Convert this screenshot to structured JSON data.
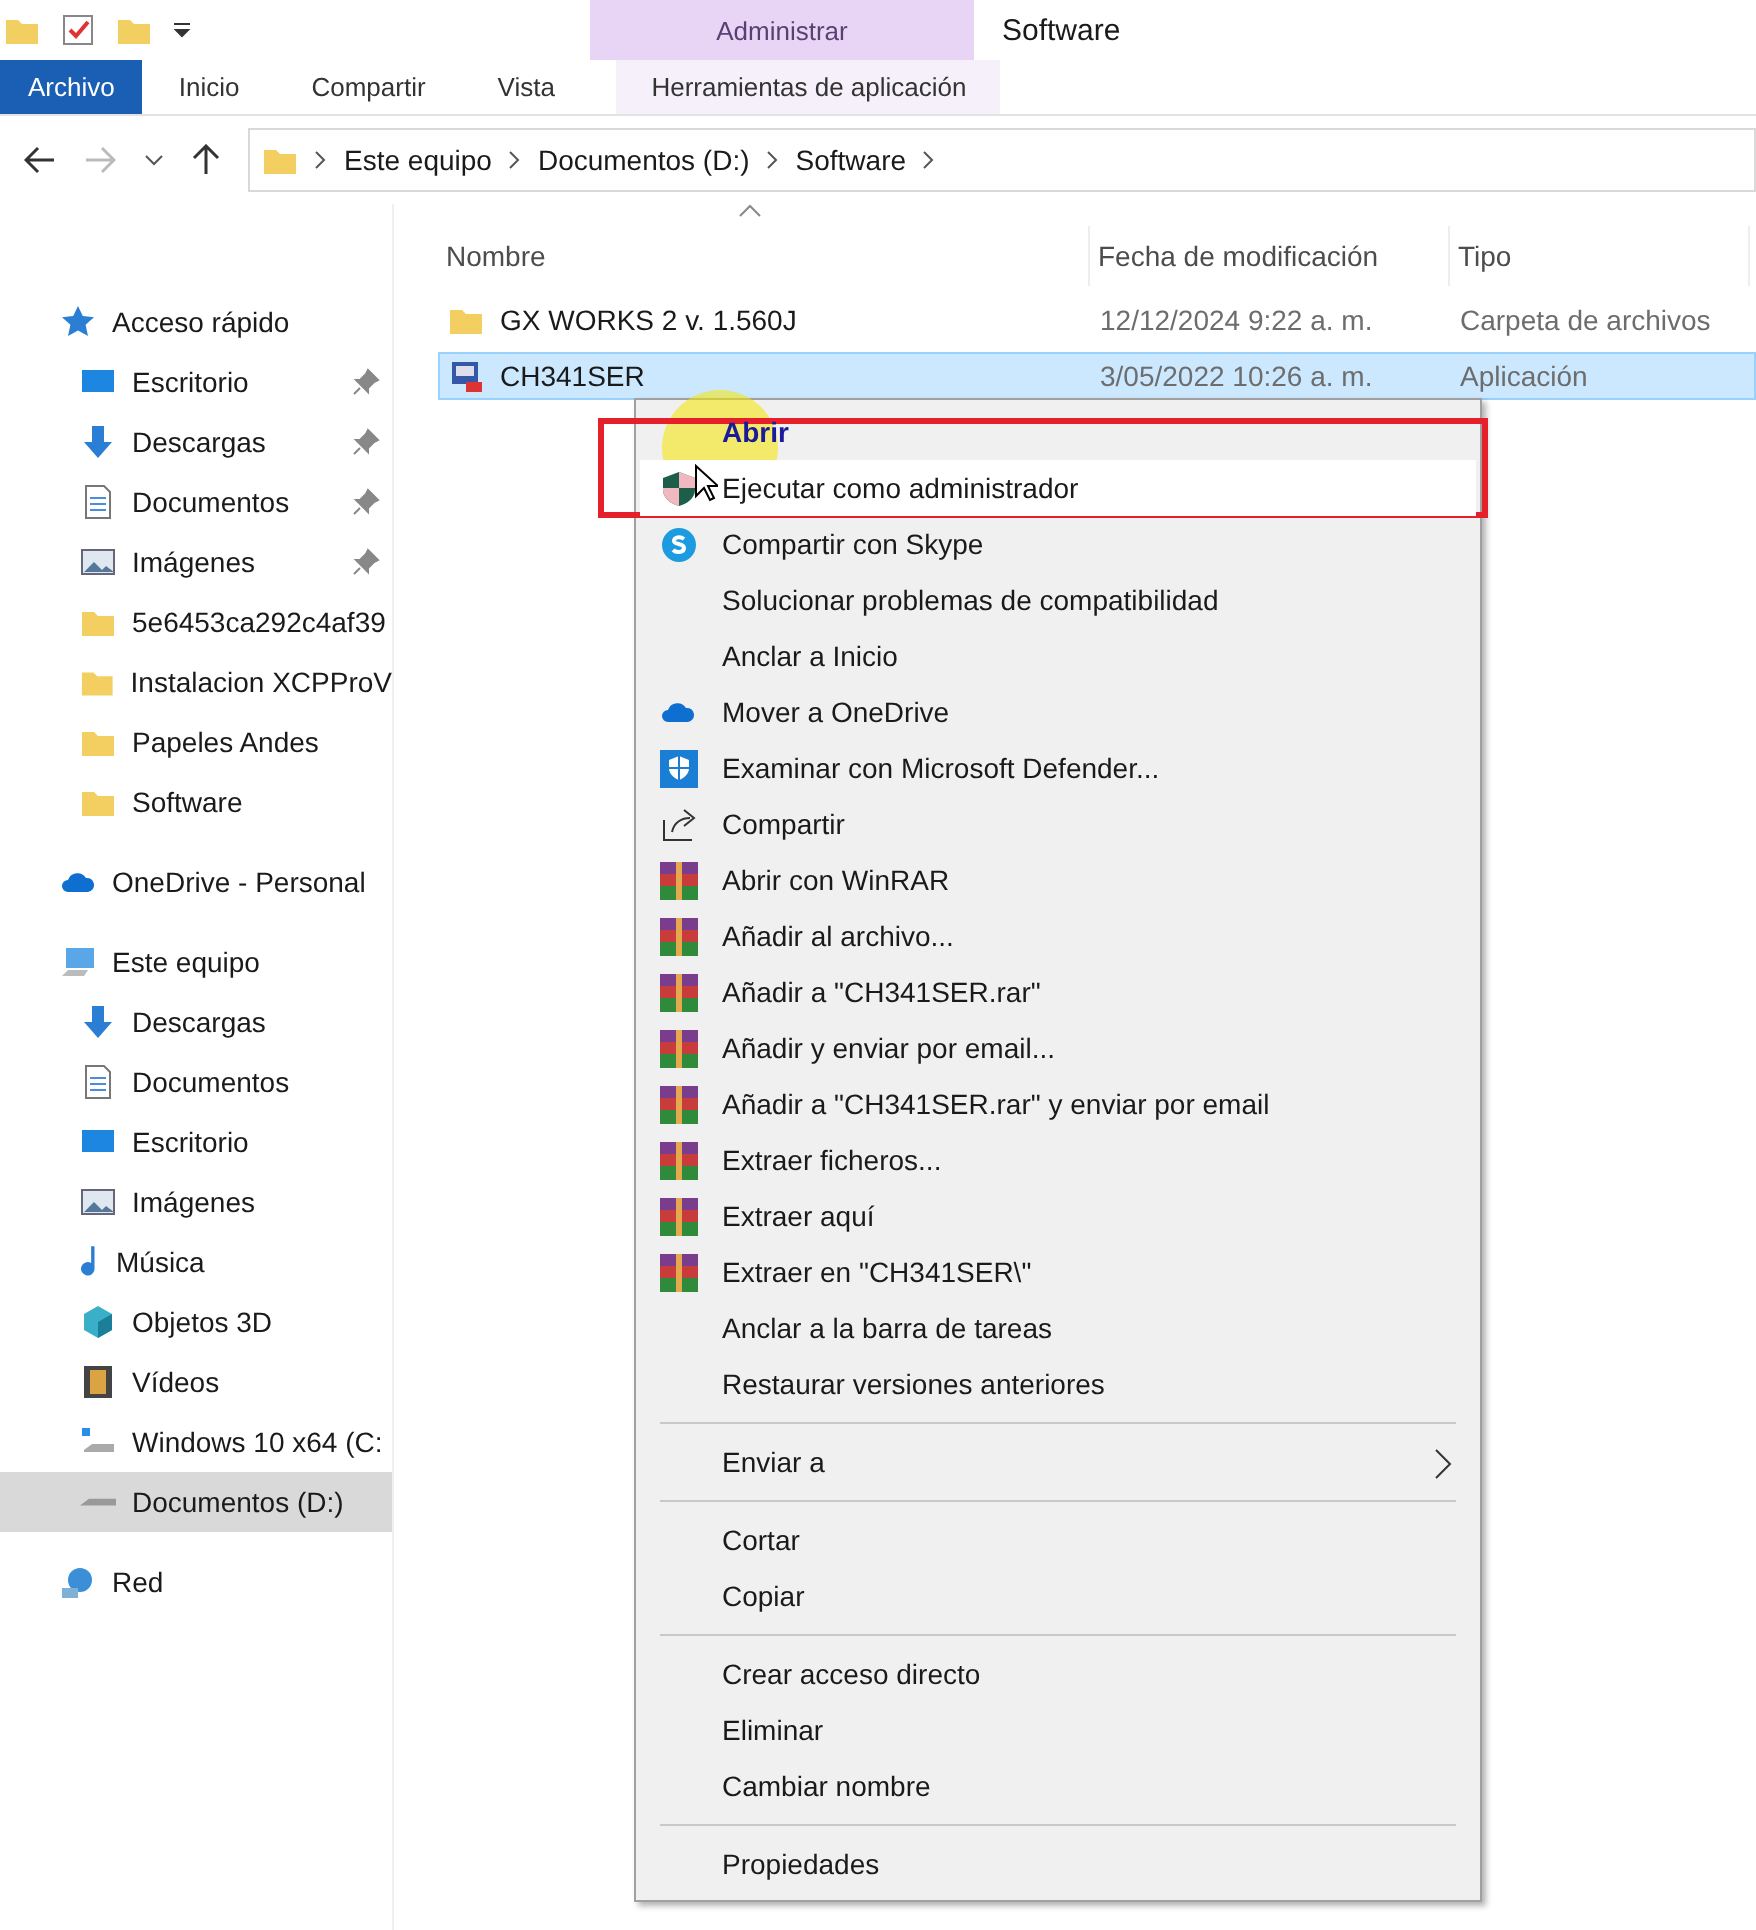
{
  "ribbon": {
    "contextual_group": "Administrar",
    "window_title": "Software",
    "tabs": [
      {
        "label": "Archivo",
        "kind": "file",
        "selected": false
      },
      {
        "label": "Inicio",
        "kind": "tab",
        "selected": false
      },
      {
        "label": "Compartir",
        "kind": "tab",
        "selected": false
      },
      {
        "label": "Vista",
        "kind": "tab",
        "selected": false
      },
      {
        "label": "Herramientas de aplicación",
        "kind": "contextual",
        "selected": false
      }
    ]
  },
  "address": {
    "crumbs": [
      "Este equipo",
      "Documentos (D:)",
      "Software"
    ]
  },
  "sidebar": {
    "items": [
      {
        "label": "Acceso rápido",
        "selected": false,
        "children": [
          {
            "label": "Escritorio",
            "pinned": true,
            "selected": false
          },
          {
            "label": "Descargas",
            "pinned": true,
            "selected": false
          },
          {
            "label": "Documentos",
            "pinned": true,
            "selected": false
          },
          {
            "label": "Imágenes",
            "pinned": true,
            "selected": false
          },
          {
            "label": "5e6453ca292c4af39",
            "pinned": false,
            "selected": false
          },
          {
            "label": "Instalacion XCPProV",
            "pinned": false,
            "selected": false
          },
          {
            "label": "Papeles Andes",
            "pinned": false,
            "selected": false
          },
          {
            "label": "Software",
            "pinned": false,
            "selected": false
          }
        ]
      },
      {
        "label": "OneDrive - Personal",
        "selected": false
      },
      {
        "label": "Este equipo",
        "selected": false,
        "children": [
          {
            "label": "Descargas",
            "pinned": false,
            "selected": false
          },
          {
            "label": "Documentos",
            "pinned": false,
            "selected": false
          },
          {
            "label": "Escritorio",
            "pinned": false,
            "selected": false
          },
          {
            "label": "Imágenes",
            "pinned": false,
            "selected": false
          },
          {
            "label": "Música",
            "pinned": false,
            "selected": false
          },
          {
            "label": "Objetos 3D",
            "pinned": false,
            "selected": false
          },
          {
            "label": "Vídeos",
            "pinned": false,
            "selected": false
          },
          {
            "label": "Windows 10 x64 (C:",
            "pinned": false,
            "selected": false
          },
          {
            "label": "Documentos (D:)",
            "pinned": false,
            "selected": true
          }
        ]
      },
      {
        "label": "Red",
        "selected": false
      }
    ]
  },
  "table": {
    "columns": [
      "Nombre",
      "Fecha de modificación",
      "Tipo"
    ],
    "rows": [
      {
        "name": "GX WORKS 2 v. 1.560J",
        "date": "12/12/2024 9:22 a. m.",
        "type": "Carpeta de archivos",
        "kind": "folder",
        "selected": false
      },
      {
        "name": "CH341SER",
        "date": "3/05/2022 10:26 a. m.",
        "type": "Aplicación",
        "kind": "application",
        "selected": true
      }
    ]
  },
  "context_menu": {
    "items": [
      {
        "kind": "item",
        "label": "Abrir",
        "bold": true,
        "hovered": false
      },
      {
        "kind": "item",
        "label": "Ejecutar como administrador",
        "bold": false,
        "hovered": true
      },
      {
        "kind": "item",
        "label": "Compartir con Skype",
        "bold": false,
        "hovered": false
      },
      {
        "kind": "item",
        "label": "Solucionar problemas de compatibilidad",
        "bold": false,
        "hovered": false
      },
      {
        "kind": "item",
        "label": "Anclar a Inicio",
        "bold": false,
        "hovered": false
      },
      {
        "kind": "item",
        "label": "Mover a OneDrive",
        "bold": false,
        "hovered": false
      },
      {
        "kind": "item",
        "label": "Examinar con Microsoft Defender...",
        "bold": false,
        "hovered": false
      },
      {
        "kind": "item",
        "label": "Compartir",
        "bold": false,
        "hovered": false
      },
      {
        "kind": "item",
        "label": "Abrir con WinRAR",
        "bold": false,
        "hovered": false
      },
      {
        "kind": "item",
        "label": "Añadir al archivo...",
        "bold": false,
        "hovered": false
      },
      {
        "kind": "item",
        "label": "Añadir a \"CH341SER.rar\"",
        "bold": false,
        "hovered": false
      },
      {
        "kind": "item",
        "label": "Añadir y enviar por email...",
        "bold": false,
        "hovered": false
      },
      {
        "kind": "item",
        "label": "Añadir a \"CH341SER.rar\" y enviar por email",
        "bold": false,
        "hovered": false
      },
      {
        "kind": "item",
        "label": "Extraer ficheros...",
        "bold": false,
        "hovered": false
      },
      {
        "kind": "item",
        "label": "Extraer aquí",
        "bold": false,
        "hovered": false
      },
      {
        "kind": "item",
        "label": "Extraer en \"CH341SER\\\"",
        "bold": false,
        "hovered": false
      },
      {
        "kind": "item",
        "label": "Anclar a la barra de tareas",
        "bold": false,
        "hovered": false
      },
      {
        "kind": "item",
        "label": "Restaurar versiones anteriores",
        "bold": false,
        "hovered": false
      },
      {
        "kind": "separator"
      },
      {
        "kind": "submenu",
        "label": "Enviar a",
        "bold": false,
        "hovered": false
      },
      {
        "kind": "separator"
      },
      {
        "kind": "item",
        "label": "Cortar",
        "bold": false,
        "hovered": false
      },
      {
        "kind": "item",
        "label": "Copiar",
        "bold": false,
        "hovered": false
      },
      {
        "kind": "separator"
      },
      {
        "kind": "item",
        "label": "Crear acceso directo",
        "bold": false,
        "hovered": false
      },
      {
        "kind": "item",
        "label": "Eliminar",
        "bold": false,
        "hovered": false
      },
      {
        "kind": "item",
        "label": "Cambiar nombre",
        "bold": false,
        "hovered": false
      },
      {
        "kind": "separator"
      },
      {
        "kind": "item",
        "label": "Propiedades",
        "bold": false,
        "hovered": false
      }
    ]
  }
}
